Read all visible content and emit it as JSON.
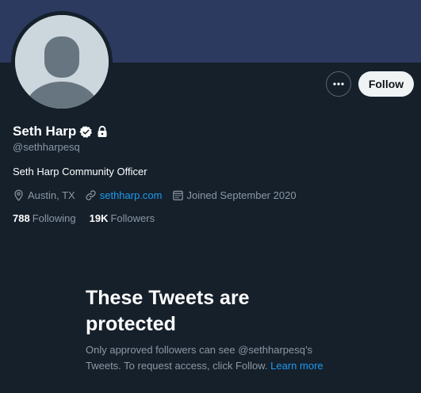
{
  "profile": {
    "name": "Seth Harp",
    "handle": "@sethharpesq",
    "bio": "Seth Harp Community Officer",
    "location": "Austin, TX",
    "website": "sethharp.com",
    "joined": "Joined September 2020",
    "following_count": "788",
    "following_label": "Following",
    "followers_count": "19K",
    "followers_label": "Followers"
  },
  "actions": {
    "follow_label": "Follow",
    "more_icon": "more-horizontal-icon"
  },
  "protected": {
    "title": "These Tweets are protected",
    "text": "Only approved followers can see @sethharpesq’s Tweets. To request access, click Follow.",
    "learn_more": "Learn more"
  },
  "colors": {
    "background": "#15202b",
    "banner": "#2c3a5f",
    "accent": "#1d9bf0",
    "secondary_text": "#8b98a5"
  }
}
